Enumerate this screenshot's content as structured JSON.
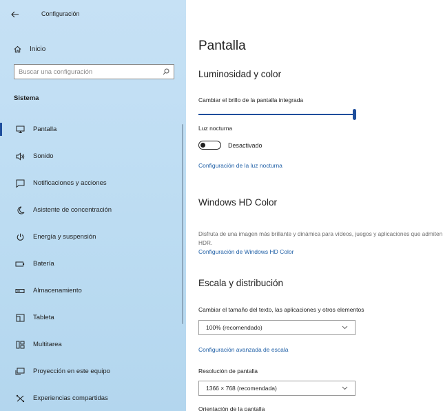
{
  "window": {
    "title": "Configuración"
  },
  "sidebar": {
    "home_label": "Inicio",
    "search": {
      "placeholder": "Buscar una configuración"
    },
    "section": "Sistema",
    "items": [
      {
        "label": "Pantalla",
        "icon": "monitor-icon",
        "selected": true
      },
      {
        "label": "Sonido",
        "icon": "speaker-icon",
        "selected": false
      },
      {
        "label": "Notificaciones y acciones",
        "icon": "notification-icon",
        "selected": false
      },
      {
        "label": "Asistente de concentración",
        "icon": "moon-icon",
        "selected": false
      },
      {
        "label": "Energía y suspensión",
        "icon": "power-icon",
        "selected": false
      },
      {
        "label": "Batería",
        "icon": "battery-icon",
        "selected": false
      },
      {
        "label": "Almacenamiento",
        "icon": "storage-icon",
        "selected": false
      },
      {
        "label": "Tableta",
        "icon": "tablet-icon",
        "selected": false
      },
      {
        "label": "Multitarea",
        "icon": "multitask-icon",
        "selected": false
      },
      {
        "label": "Proyección en este equipo",
        "icon": "projection-icon",
        "selected": false
      },
      {
        "label": "Experiencias compartidas",
        "icon": "shared-icon",
        "selected": false
      }
    ]
  },
  "main": {
    "title": "Pantalla",
    "brightness": {
      "heading": "Luminosidad y color",
      "slider_label": "Cambiar el brillo de la pantalla integrada",
      "value_percent": 100,
      "night_light_label": "Luz nocturna",
      "night_light_state": "Desactivado",
      "night_light_link": "Configuración de la luz nocturna"
    },
    "hdr": {
      "heading": "Windows HD Color",
      "description": "Disfruta de una imagen más brillante y dinámica para vídeos, juegos y aplicaciones que admiten HDR.",
      "link": "Configuración de Windows HD Color"
    },
    "scale": {
      "heading": "Escala y distribución",
      "size_label": "Cambiar el tamaño del texto, las aplicaciones y otros elementos",
      "size_value": "100% (recomendado)",
      "advanced_link": "Configuración avanzada de escala",
      "resolution_label": "Resolución de pantalla",
      "resolution_value": "1366 × 768 (recomendada)",
      "orientation_label": "Orientación de la pantalla"
    }
  },
  "colors": {
    "accent": "#1f4e9c",
    "link": "#1f5fa6",
    "sidebar_bg": "#c6e1f5"
  }
}
